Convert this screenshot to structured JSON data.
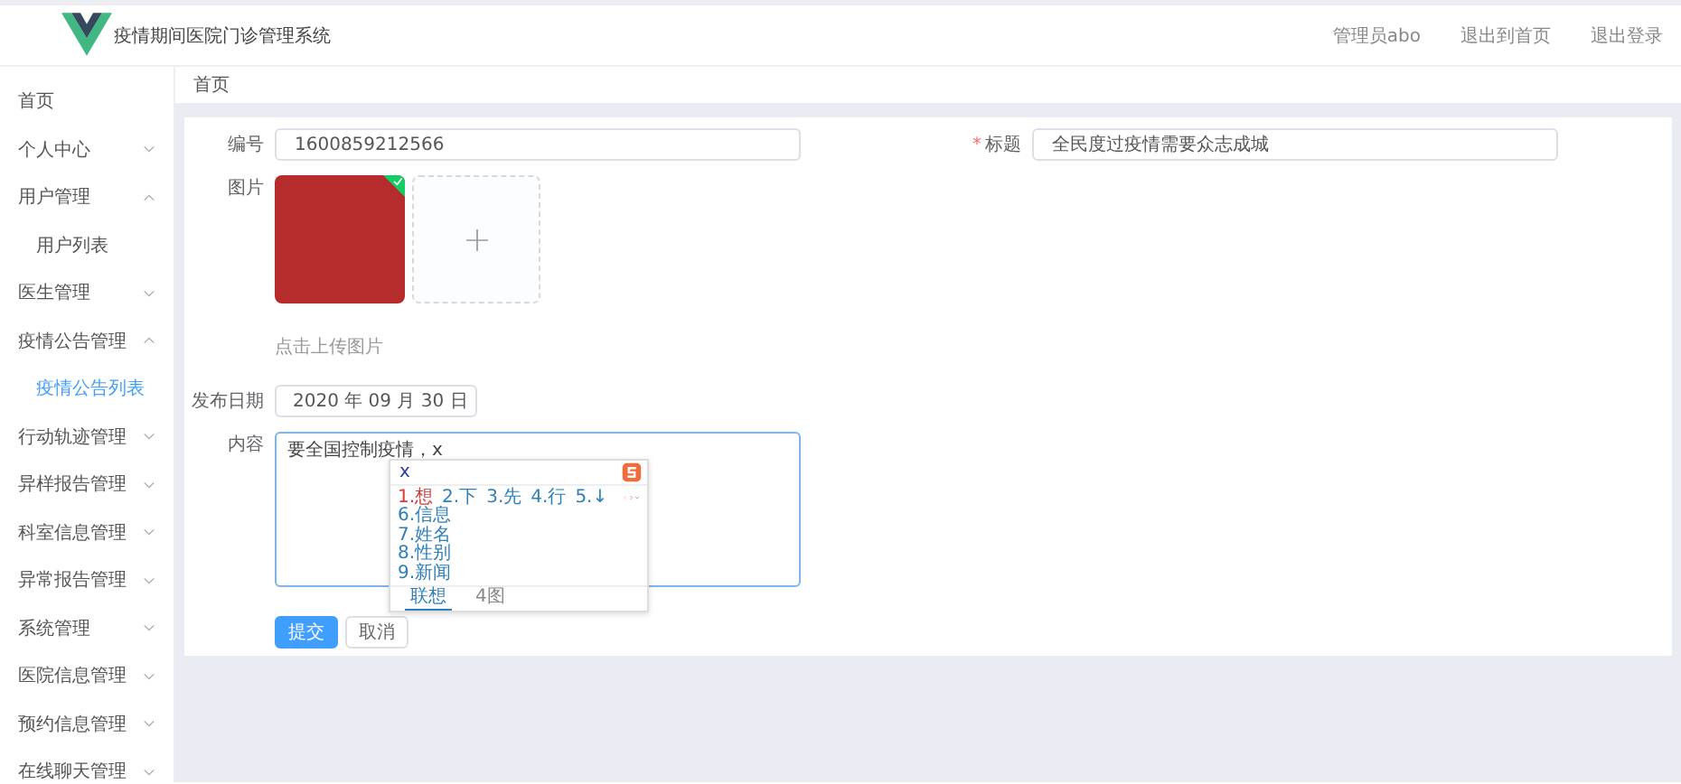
{
  "header": {
    "title": "疫情期间医院门诊管理系统",
    "links": [
      "管理员abo",
      "退出到首页",
      "退出登录"
    ]
  },
  "sidebar": {
    "items": [
      {
        "label": "首页",
        "selected": false
      },
      {
        "label": "个人中心",
        "selected": false,
        "expanded": false
      },
      {
        "label": "用户管理",
        "selected": false,
        "expanded": true,
        "children": [
          {
            "label": "用户列表",
            "selected": false
          }
        ]
      },
      {
        "label": "医生管理",
        "selected": false,
        "expanded": false
      },
      {
        "label": "疫情公告管理",
        "selected": false,
        "expanded": true,
        "children": [
          {
            "label": "疫情公告列表",
            "selected": true
          }
        ]
      },
      {
        "label": "行动轨迹管理",
        "selected": false,
        "expanded": false
      },
      {
        "label": "异样报告管理",
        "selected": false,
        "expanded": false
      },
      {
        "label": "科室信息管理",
        "selected": false,
        "expanded": false
      },
      {
        "label": "异常报告管理",
        "selected": false,
        "expanded": false
      },
      {
        "label": "系统管理",
        "selected": false,
        "expanded": false
      },
      {
        "label": "医院信息管理",
        "selected": false,
        "expanded": false
      },
      {
        "label": "预约信息管理",
        "selected": false,
        "expanded": false
      },
      {
        "label": "在线聊天管理",
        "selected": false,
        "expanded": false
      }
    ]
  },
  "breadcrumb": [
    "首页"
  ],
  "form": {
    "number": {
      "label": "编号",
      "value": "1600859212566"
    },
    "title": {
      "label": "标题",
      "required_mark": "*",
      "value": "全民度过疫情需要众志成城"
    },
    "image": {
      "label": "图片",
      "uploaded": [
        {
          "success": true
        }
      ],
      "hint": "点击上传图片"
    },
    "date": {
      "label": "发布日期",
      "value": "2020 年 09 月 30 日"
    },
    "content": {
      "label": "内容",
      "value": "要全国控制疫情，x"
    },
    "buttons": [
      {
        "label": "提交",
        "kind": "primary"
      },
      {
        "label": "取消",
        "kind": "default"
      }
    ]
  },
  "ime": {
    "input": "x",
    "row": [
      {
        "label": "1.想",
        "selected": true
      },
      {
        "label": "2.下",
        "selected": false
      },
      {
        "label": "3.先",
        "selected": false
      },
      {
        "label": "4.行",
        "selected": false
      },
      {
        "label": "5.↓",
        "selected": false
      }
    ],
    "list": [
      {
        "label": "6.信息",
        "selected": false
      },
      {
        "label": "7.姓名",
        "selected": false
      },
      {
        "label": "8.性别",
        "selected": false
      },
      {
        "label": "9.新闻",
        "selected": false
      }
    ],
    "tabs": [
      {
        "label": "联想",
        "selected": true
      },
      {
        "label": "4图",
        "selected": false
      }
    ]
  }
}
